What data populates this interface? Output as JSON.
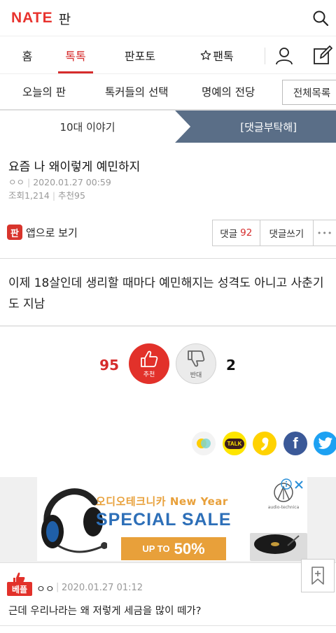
{
  "header": {
    "brand": "NATE",
    "section": "판"
  },
  "nav": {
    "items": [
      {
        "label": "홈"
      },
      {
        "label": "톡톡",
        "active": true
      },
      {
        "label": "판포토"
      },
      {
        "label": "팬톡",
        "icon": "star-icon"
      }
    ]
  },
  "subnav": {
    "items": [
      {
        "label": "오늘의 판"
      },
      {
        "label": "톡커들의 선택"
      },
      {
        "label": "명예의 전당"
      }
    ],
    "all_list": "전체목록"
  },
  "story_nav": {
    "prev": "10대 이야기",
    "next": "[댓글부탁해]",
    "next_bg": "#5a6e87"
  },
  "post": {
    "title": "요즘 나 왜이렇게 예민하지",
    "author": "ㅇㅇ",
    "date": "2020.01.27 00:59",
    "views_label": "조회",
    "views": "1,214",
    "recommend_label": "추천",
    "recommend": "95",
    "body": "이제 18살인데 생리할 때마다 예민해지는 성격도 아니고 사춘기도 지남"
  },
  "app_view": {
    "icon_char": "판",
    "label": "앱으로 보기"
  },
  "comment_bar": {
    "comments_label": "댓글",
    "comments_count": "92",
    "write_label": "댓글쓰기",
    "more": "•••"
  },
  "votes": {
    "up_count": "95",
    "up_label": "추천",
    "down_label": "반대",
    "down_count": "2",
    "up_color": "#e2312a"
  },
  "share": [
    {
      "name": "kakaostory-icon",
      "color": "#f3f3f3"
    },
    {
      "name": "kakaotalk-icon",
      "color": "#fee500",
      "text": "TALK"
    },
    {
      "name": "band-icon",
      "color": "#ffd200"
    },
    {
      "name": "facebook-icon",
      "color": "#3b5998",
      "text": "f"
    },
    {
      "name": "twitter-icon",
      "color": "#1da1f2"
    }
  ],
  "ad": {
    "headline": "오디오테크니카 New Year",
    "sale": "SPECIAL SALE",
    "badge_small": "UP TO",
    "badge_big": "50%",
    "brand_sub": "audio-technica"
  },
  "best_comment": {
    "badge": "베플",
    "author": "ㅇㅇ",
    "date": "2020.01.27 01:12",
    "text": "근데 우리나라는 왜 저렇게 세금을 많이 떼가?"
  }
}
